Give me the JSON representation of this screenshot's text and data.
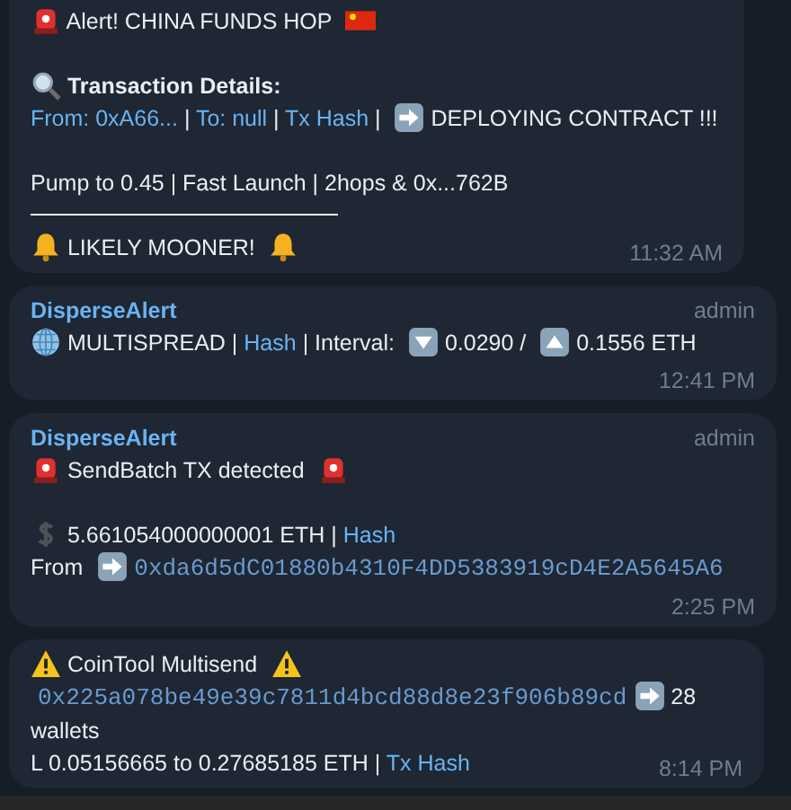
{
  "messages": [
    {
      "time": "11:32 AM",
      "lines": [
        {
          "kind": "text",
          "segments": [
            {
              "kind": "siren"
            },
            {
              "kind": "text",
              "text": " Alert! CHINA FUNDS HOP "
            },
            {
              "kind": "flag"
            }
          ]
        },
        {
          "kind": "blank"
        },
        {
          "kind": "text",
          "segments": [
            {
              "kind": "magnifier"
            },
            {
              "kind": "bold",
              "text": " Transaction Details:"
            }
          ]
        },
        {
          "kind": "text",
          "segments": [
            {
              "kind": "link",
              "text": "From: 0xA66..."
            },
            {
              "kind": "text",
              "text": " | "
            },
            {
              "kind": "link",
              "text": "To: null"
            },
            {
              "kind": "text",
              "text": " | "
            },
            {
              "kind": "link",
              "text": "Tx Hash"
            },
            {
              "kind": "text",
              "text": " | "
            },
            {
              "kind": "arrow"
            },
            {
              "kind": "text",
              "text": " DEPLOYING CONTRACT !!!"
            }
          ]
        },
        {
          "kind": "blank"
        },
        {
          "kind": "text",
          "segments": [
            {
              "kind": "text",
              "text": "Pump to 0.45 | Fast Launch | 2hops & 0x...762B"
            }
          ]
        },
        {
          "kind": "rule"
        },
        {
          "kind": "text",
          "segments": [
            {
              "kind": "bell"
            },
            {
              "kind": "text",
              "text": " LIKELY MOONER! "
            },
            {
              "kind": "bell"
            }
          ]
        }
      ]
    },
    {
      "sender": "DisperseAlert",
      "role": "admin",
      "time": "12:41 PM",
      "lines": [
        {
          "kind": "text",
          "segments": [
            {
              "kind": "globe"
            },
            {
              "kind": "text",
              "text": " MULTISPREAD | "
            },
            {
              "kind": "link",
              "text": "Hash"
            },
            {
              "kind": "text",
              "text": " | Interval: "
            },
            {
              "kind": "down"
            },
            {
              "kind": "text",
              "text": " 0.0290 / "
            },
            {
              "kind": "up"
            },
            {
              "kind": "text",
              "text": " 0.1556 ETH"
            }
          ]
        }
      ]
    },
    {
      "sender": "DisperseAlert",
      "role": "admin",
      "time": "2:25 PM",
      "lines": [
        {
          "kind": "text",
          "segments": [
            {
              "kind": "siren"
            },
            {
              "kind": "text",
              "text": " SendBatch TX detected "
            },
            {
              "kind": "siren"
            }
          ]
        },
        {
          "kind": "blank"
        },
        {
          "kind": "text",
          "segments": [
            {
              "kind": "dollar"
            },
            {
              "kind": "text",
              "text": " 5.661054000000001 ETH | "
            },
            {
              "kind": "link",
              "text": "Hash"
            }
          ]
        },
        {
          "kind": "text",
          "segments": [
            {
              "kind": "text",
              "text": "From "
            },
            {
              "kind": "arrow"
            },
            {
              "kind": "mono",
              "text": "0xda6d5dC01880b4310F4DD5383919cD4E2A5645A6"
            }
          ]
        }
      ]
    },
    {
      "time": "8:14 PM",
      "lines": [
        {
          "kind": "text",
          "segments": [
            {
              "kind": "warning"
            },
            {
              "kind": "text",
              "text": " CoinTool Multisend "
            },
            {
              "kind": "warning"
            }
          ]
        },
        {
          "kind": "text",
          "segments": [
            {
              "kind": "mono",
              "text": "0x225a078be49e39c7811d4bcd88d8e23f906b89cd"
            },
            {
              "kind": "arrow"
            },
            {
              "kind": "text",
              "text": " 28 wallets"
            }
          ]
        },
        {
          "kind": "text",
          "segments": [
            {
              "kind": "text",
              "text": "L 0.05156665 to 0.27685185 ETH | "
            },
            {
              "kind": "link",
              "text": "Tx Hash"
            }
          ]
        }
      ]
    }
  ]
}
